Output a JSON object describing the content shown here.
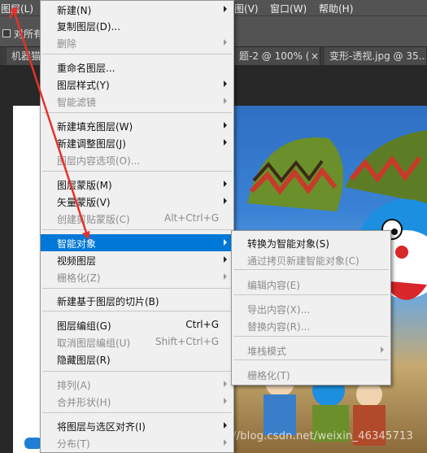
{
  "menubar": {
    "layer_menu": "图层(L)",
    "view_menu": "图(V)",
    "window_menu": "窗口(W)",
    "help_menu": "帮助(H)"
  },
  "options_bar": {
    "checkbox_label": "对所有"
  },
  "tabs": [
    {
      "label": "机器猫"
    },
    {
      "label": "题-2 @ 100% ("
    },
    {
      "label": "变形-透视.jpg @ 35..."
    }
  ],
  "tab_close_glyph": "×",
  "watermark": "https://blog.csdn.net/weixin_46345713",
  "layer_menu": {
    "items": [
      {
        "label": "新建(N)",
        "disabled": false,
        "submenu": true
      },
      {
        "label": "复制图层(D)...",
        "disabled": false,
        "submenu": false
      },
      {
        "label": "删除",
        "disabled": true,
        "submenu": true
      },
      {
        "label": "重命名图层...",
        "disabled": false,
        "submenu": false
      },
      {
        "label": "图层样式(Y)",
        "disabled": false,
        "submenu": true
      },
      {
        "label": "智能滤镜",
        "disabled": true,
        "submenu": true
      },
      {
        "label": "新建填充图层(W)",
        "disabled": false,
        "submenu": true
      },
      {
        "label": "新建调整图层(J)",
        "disabled": false,
        "submenu": true
      },
      {
        "label": "图层内容选项(O)...",
        "disabled": true,
        "submenu": false
      },
      {
        "label": "图层蒙版(M)",
        "disabled": false,
        "submenu": true
      },
      {
        "label": "矢量蒙版(V)",
        "disabled": false,
        "submenu": true
      },
      {
        "label": "创建剪贴蒙版(C)",
        "disabled": true,
        "submenu": false,
        "shortcut": "Alt+Ctrl+G"
      },
      {
        "label": "智能对象",
        "disabled": false,
        "submenu": true,
        "highlighted": true
      },
      {
        "label": "视频图层",
        "disabled": false,
        "submenu": true
      },
      {
        "label": "栅格化(Z)",
        "disabled": true,
        "submenu": true
      },
      {
        "label": "新建基于图层的切片(B)",
        "disabled": false,
        "submenu": false
      },
      {
        "label": "图层编组(G)",
        "disabled": false,
        "submenu": false,
        "shortcut": "Ctrl+G"
      },
      {
        "label": "取消图层编组(U)",
        "disabled": true,
        "submenu": false,
        "shortcut": "Shift+Ctrl+G"
      },
      {
        "label": "隐藏图层(R)",
        "disabled": false,
        "submenu": false
      },
      {
        "label": "排列(A)",
        "disabled": true,
        "submenu": true
      },
      {
        "label": "合并形状(H)",
        "disabled": true,
        "submenu": true
      },
      {
        "label": "将图层与选区对齐(I)",
        "disabled": false,
        "submenu": true
      },
      {
        "label": "分布(T)",
        "disabled": true,
        "submenu": true
      }
    ]
  },
  "smart_object_submenu": {
    "items": [
      {
        "label": "转换为智能对象(S)",
        "disabled": false,
        "submenu": false
      },
      {
        "label": "通过拷贝新建智能对象(C)",
        "disabled": true,
        "submenu": false
      },
      {
        "label": "编辑内容(E)",
        "disabled": true,
        "submenu": false
      },
      {
        "label": "导出内容(X)...",
        "disabled": true,
        "submenu": false
      },
      {
        "label": "替换内容(R)...",
        "disabled": true,
        "submenu": false
      },
      {
        "label": "堆栈模式",
        "disabled": true,
        "submenu": true
      },
      {
        "label": "栅格化(T)",
        "disabled": true,
        "submenu": false
      }
    ]
  },
  "colors": {
    "highlight": "#0078d7",
    "menu_bg": "#f0f0f0",
    "annotation_red": "#e8312a",
    "app_chrome": "#535353"
  },
  "icons": {
    "submenu_arrow": "chevron-right-icon",
    "annotation_arrows": "red-arrow-icon"
  }
}
